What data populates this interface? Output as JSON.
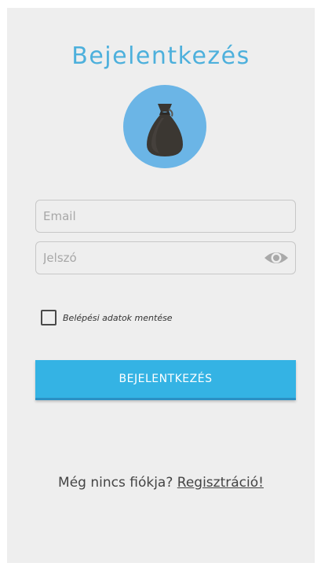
{
  "login": {
    "title": "Bejelentkezés",
    "email_placeholder": "Email",
    "password_placeholder": "Jelszó",
    "remember_label": "Belépési adatok mentése",
    "remember_checked": false,
    "submit_label": "BEJELENTKEZÉS",
    "register_prompt": "Még nincs fiókja?",
    "register_link": "Regisztráció!"
  },
  "icons": {
    "avatar": "money-bag-icon",
    "password_toggle": "eye-icon"
  },
  "colors": {
    "accent": "#34b3e4",
    "title": "#4db0dc",
    "avatar_bg": "#6bb5e6",
    "background": "#eeeeee"
  }
}
